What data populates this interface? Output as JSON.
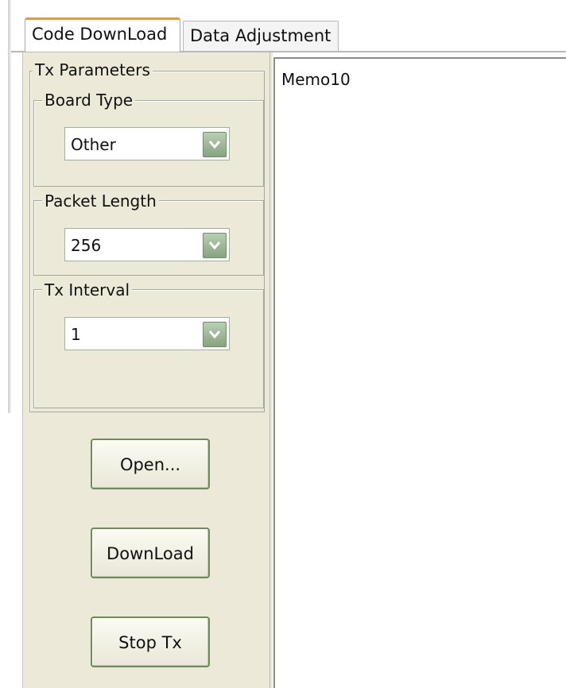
{
  "tabs": [
    {
      "label": "Code DownLoad",
      "active": true
    },
    {
      "label": "Data Adjustment",
      "active": false
    }
  ],
  "tx_parameters": {
    "title": "Tx Parameters",
    "board_type": {
      "label": "Board Type",
      "value": "Other"
    },
    "packet_length": {
      "label": "Packet Length",
      "value": "256"
    },
    "tx_interval": {
      "label": "Tx Interval",
      "value": "1"
    }
  },
  "buttons": {
    "open": "Open...",
    "download": "DownLoad",
    "stop_tx": "Stop Tx"
  },
  "memo": {
    "text": "Memo10"
  },
  "colors": {
    "panel_bg": "#ece9d8",
    "active_tab_accent": "#e39a3a",
    "combo_button": "#86a37f",
    "button_border": "#6e8b5a"
  }
}
